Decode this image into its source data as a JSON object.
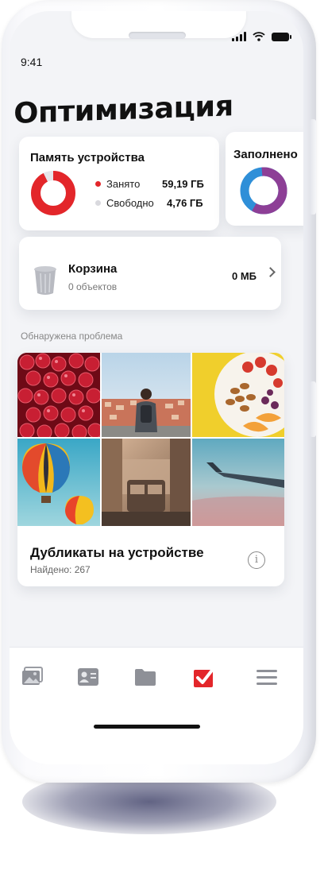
{
  "status_bar": {
    "time": "9:41"
  },
  "header": {
    "title": "Оптимизация"
  },
  "memory_card": {
    "title": "Память устройства",
    "used_label": "Занято",
    "used_value": "59,19 ГБ",
    "free_label": "Свободно",
    "free_value": "4,76 ГБ",
    "used_fraction": 0.926,
    "colors": {
      "used": "#e3262a",
      "free": "#e6e6ea"
    }
  },
  "fill_card": {
    "title": "Заполнено",
    "colors": {
      "a": "#8d3f96",
      "b": "#2f8fd8"
    }
  },
  "trash_card": {
    "title": "Корзина",
    "count": "0 объектов",
    "size": "0 МБ"
  },
  "problem_section": {
    "label": "Обнаружена проблема"
  },
  "duplicates_card": {
    "title": "Дубликаты на устройстве",
    "found": "Найдено: 267"
  },
  "tabbar": {
    "items": [
      {
        "icon": "gallery-icon",
        "active": false
      },
      {
        "icon": "contacts-icon",
        "active": false
      },
      {
        "icon": "folder-icon",
        "active": false
      },
      {
        "icon": "checkbox-icon",
        "active": true
      },
      {
        "icon": "menu-icon",
        "active": false
      }
    ],
    "accent": "#e3262a"
  }
}
